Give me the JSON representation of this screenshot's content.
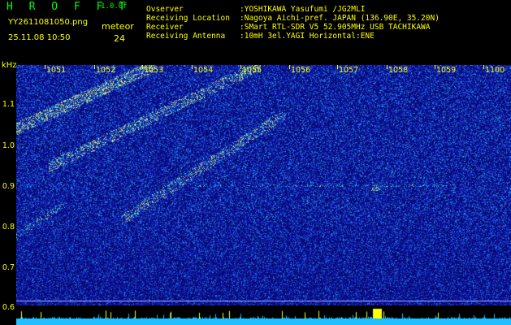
{
  "header": {
    "app_title": "H R O F F T",
    "app_version": "1.0.0f",
    "file_name": "YY2611081050.png",
    "timestamp": "25.11.08 10:50",
    "mode_label": "meteor",
    "count_value": "24",
    "info": [
      {
        "key": "Ovserver",
        "value": ":YOSHIKAWA Yasufumi /JG2MLI"
      },
      {
        "key": "Receiving Location",
        "value": ":Nagoya Aichi-pref. JAPAN (136.90E, 35.20N)"
      },
      {
        "key": "Receiver",
        "value": ":SMart RTL-SDR V5 52.905MHz USB TACHIKAWA"
      },
      {
        "key": "Receiving Antenna",
        "value": ":10mH 3el.YAGI Horizontal:ENE"
      }
    ]
  },
  "axes": {
    "y_unit": "kHz",
    "y_ticks": [
      "1.1",
      "1.0",
      "0.9",
      "0.8",
      "0.7",
      "0.6"
    ],
    "x_ticks": [
      "1051",
      "1052",
      "1053",
      "1054",
      "1055",
      "1056",
      "1057",
      "1058",
      "1059",
      "1100"
    ]
  },
  "colors": {
    "background": "#000000",
    "text": "#ffff00",
    "title": "#00ff00",
    "plot_base": "#0a0a6a",
    "baseline": "#1ec0ff"
  }
}
